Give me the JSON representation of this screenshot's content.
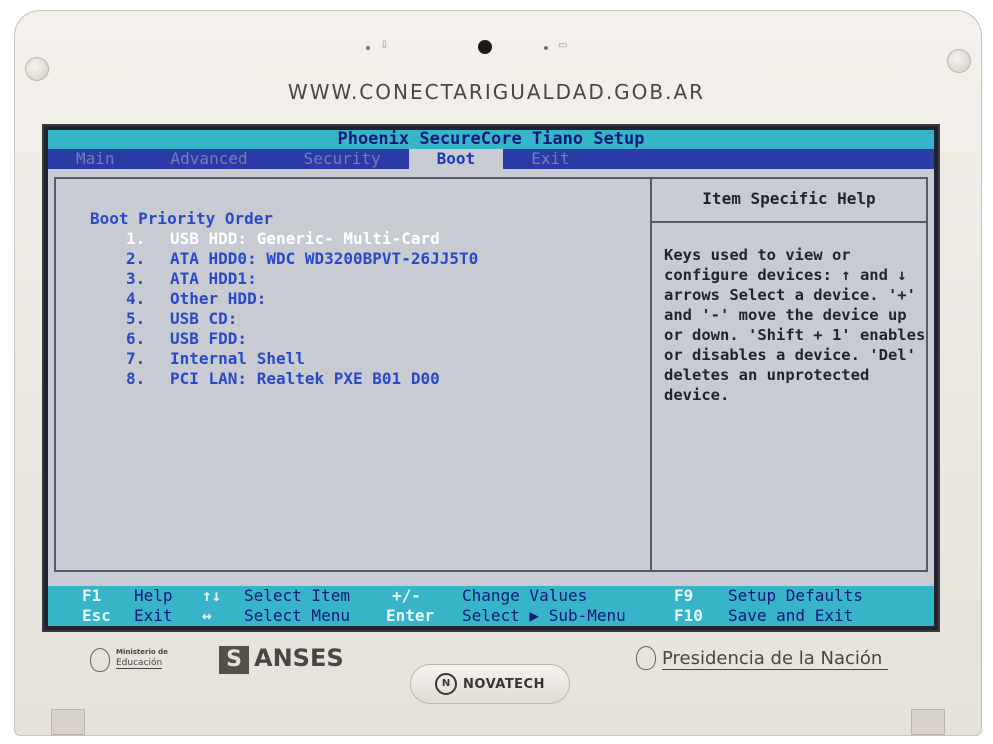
{
  "bezel": {
    "url": "WWW.CONECTARIGUALDAD.GOB.AR",
    "ministerio_line1": "Ministerio de",
    "ministerio_line2": "Educación",
    "anses_mark": "S",
    "anses": "ANSES",
    "novatech_mark": "N",
    "novatech": "NOVATECH",
    "presidencia": "Presidencia de la Nación"
  },
  "bios": {
    "title": "Phoenix SecureCore Tiano Setup",
    "menu": [
      {
        "label": "Main",
        "active": false
      },
      {
        "label": "Advanced",
        "active": false
      },
      {
        "label": "Security",
        "active": false
      },
      {
        "label": "Boot",
        "active": true
      },
      {
        "label": "Exit",
        "active": false
      }
    ],
    "section_title": "Boot Priority Order",
    "boot_items": [
      {
        "num": "1.",
        "label": "USB HDD: Generic- Multi-Card",
        "selected": true
      },
      {
        "num": "2.",
        "label": "ATA HDD0: WDC WD3200BPVT-26JJ5T0",
        "selected": false
      },
      {
        "num": "3.",
        "label": "ATA HDD1:",
        "selected": false
      },
      {
        "num": "4.",
        "label": "Other HDD:",
        "selected": false
      },
      {
        "num": "5.",
        "label": "USB CD:",
        "selected": false
      },
      {
        "num": "6.",
        "label": "USB FDD:",
        "selected": false
      },
      {
        "num": "7.",
        "label": "Internal Shell",
        "selected": false
      },
      {
        "num": "8.",
        "label": "PCI LAN: Realtek PXE B01 D00",
        "selected": false
      }
    ],
    "help_title": "Item Specific Help",
    "help_text": "Keys used to view or configure devices: ↑ and ↓ arrows Select a device. '+' and '-' move the device up or down. 'Shift + 1' enables or disables a device. 'Del' deletes an unprotected device.",
    "footer": {
      "f1_key": "F1",
      "f1_desc": "Help",
      "ud_key": "↑↓",
      "ud_desc": "Select Item",
      "pm_key": "+/-",
      "pm_desc": "Change Values",
      "f9_key": "F9",
      "f9_desc": "Setup Defaults",
      "esc_key": "Esc",
      "esc_desc": "Exit",
      "lr_key": "↔",
      "lr_desc": "Select Menu",
      "enter_key": "Enter",
      "enter_desc": "Select ▶ Sub-Menu",
      "f10_key": "F10",
      "f10_desc": "Save and Exit"
    }
  }
}
